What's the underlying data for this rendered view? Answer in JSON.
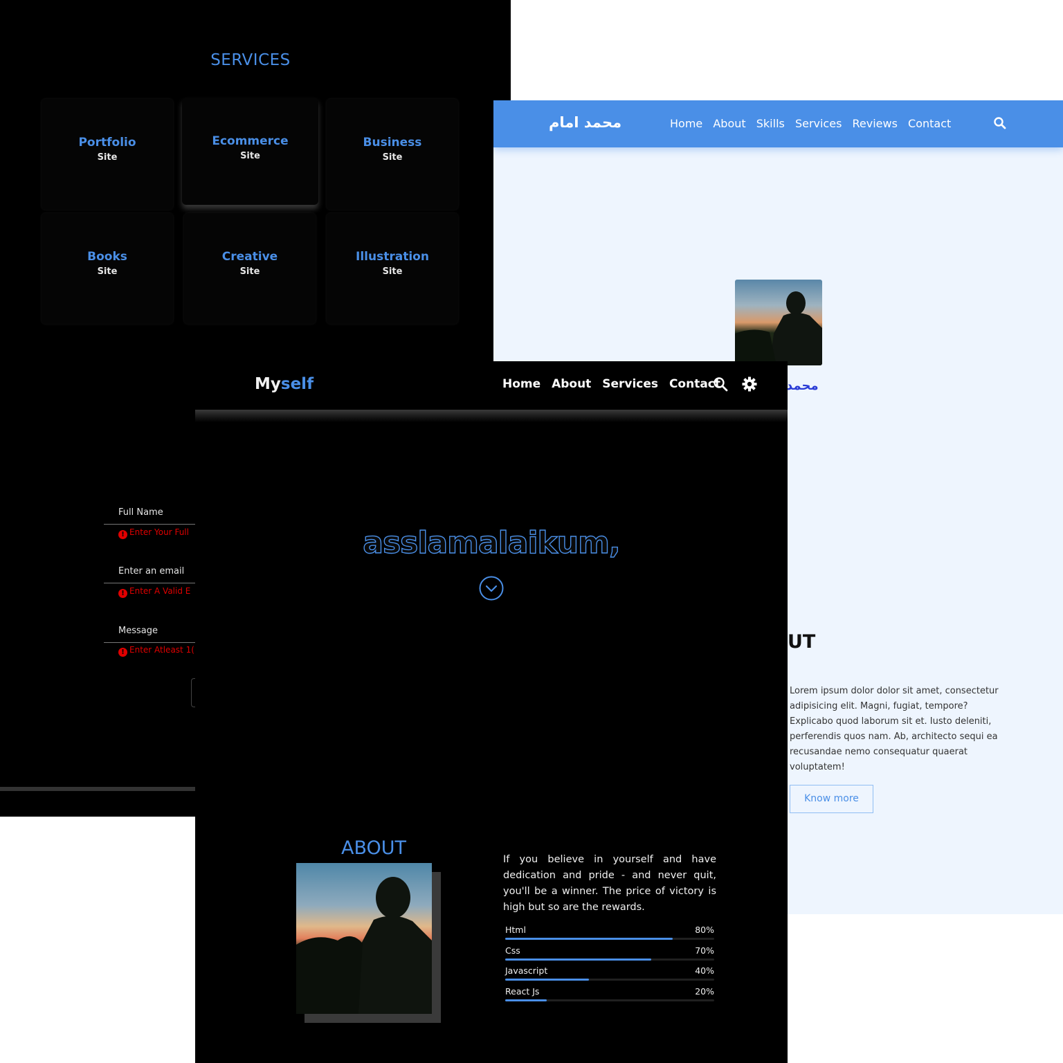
{
  "panel_dark_services": {
    "services_title": "SERVICES",
    "cards": [
      {
        "title": "Portfolio",
        "subtitle": "Site"
      },
      {
        "title": "Ecommerce",
        "subtitle": "Site"
      },
      {
        "title": "Business",
        "subtitle": "Site"
      },
      {
        "title": "Books",
        "subtitle": "Site"
      },
      {
        "title": "Creative",
        "subtitle": "Site"
      },
      {
        "title": "Illustration",
        "subtitle": "Site"
      }
    ],
    "form": {
      "name_label": "Full Name",
      "name_error": "Enter Your Full",
      "email_label": "Enter an email",
      "email_error": "Enter A Valid E",
      "message_label": "Message",
      "message_error": "Enter Atleast 1("
    }
  },
  "panel_light_arabic": {
    "logo": "محمد امام",
    "nav": [
      "Home",
      "About",
      "Skills",
      "Services",
      "Reviews",
      "Contact"
    ],
    "name_partial": "محمد",
    "about_heading_partial": "UT",
    "about_text": "Lorem ipsum dolor dolor sit amet, consectetur adipisicing elit. Magni, fugiat, tempore? Explicabo quod laborum sit et. Iusto deleniti, perferendis quos nam. Ab, architecto sequi ea recusandae nemo consequatur quaerat voluptatem!",
    "know_more": "Know more",
    "accent": "#4a8fe7",
    "background": "#eef5fe"
  },
  "panel_myself": {
    "brand_my": "My",
    "brand_self": "self",
    "nav": [
      "Home",
      "About",
      "Services",
      "Contact"
    ],
    "hero": "asslamalaikum,",
    "about_heading": "ABOUT",
    "quote": "If you believe in yourself and have dedication and pride - and never quit, you'll be a winner. The price of victory is high but so are the rewards.",
    "skills": [
      {
        "name": "Html",
        "percent": 80,
        "label": "80%"
      },
      {
        "name": "Css",
        "percent": 70,
        "label": "70%"
      },
      {
        "name": "Javascript",
        "percent": 40,
        "label": "40%"
      },
      {
        "name": "React Js",
        "percent": 20,
        "label": "20%"
      }
    ],
    "accent": "#4a8fe7"
  }
}
